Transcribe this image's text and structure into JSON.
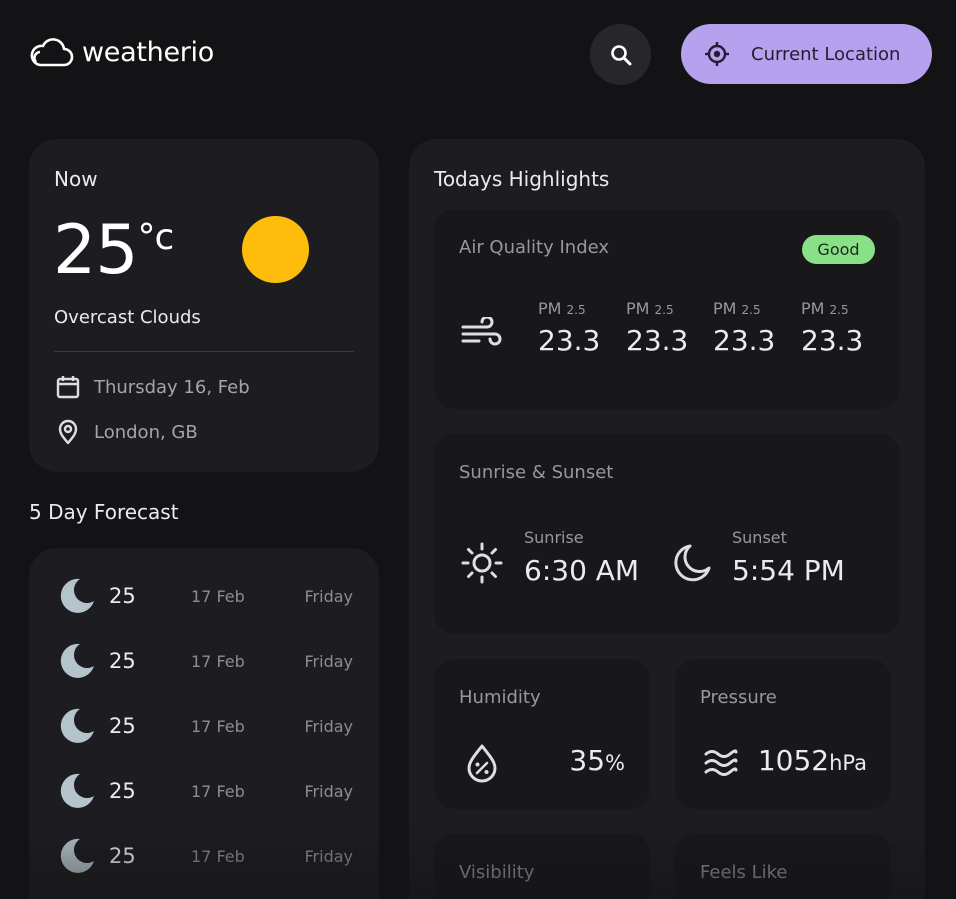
{
  "app": {
    "name": "weatherio"
  },
  "header": {
    "search_icon": "search-icon",
    "location_button": {
      "label": "Current Location",
      "icon": "crosshair-icon"
    }
  },
  "current": {
    "title": "Now",
    "temp": "25",
    "unit": "°c",
    "description": "Overcast Clouds",
    "date": "Thursday 16, Feb",
    "location": "London, GB",
    "sun_color": "#fdbd0a"
  },
  "forecast": {
    "title": "5 Day Forecast",
    "items": [
      {
        "temp": "25",
        "date": "17 Feb",
        "day": "Friday",
        "icon": "moon-icon"
      },
      {
        "temp": "25",
        "date": "17 Feb",
        "day": "Friday",
        "icon": "moon-icon"
      },
      {
        "temp": "25",
        "date": "17 Feb",
        "day": "Friday",
        "icon": "moon-icon"
      },
      {
        "temp": "25",
        "date": "17 Feb",
        "day": "Friday",
        "icon": "moon-icon"
      },
      {
        "temp": "25",
        "date": "17 Feb",
        "day": "Friday",
        "icon": "moon-icon"
      }
    ]
  },
  "highlights": {
    "title": "Todays Highlights",
    "aqi": {
      "label": "Air Quality Index",
      "badge": "Good",
      "badge_color": "#89e087",
      "items": [
        {
          "label": "PM",
          "sub": "2.5",
          "value": "23.3"
        },
        {
          "label": "PM",
          "sub": "2.5",
          "value": "23.3"
        },
        {
          "label": "PM",
          "sub": "2.5",
          "value": "23.3"
        },
        {
          "label": "PM",
          "sub": "2.5",
          "value": "23.3"
        }
      ]
    },
    "sun": {
      "label": "Sunrise & Sunset",
      "sunrise_label": "Sunrise",
      "sunrise": "6:30 AM",
      "sunset_label": "Sunset",
      "sunset": "5:54 PM"
    },
    "humidity": {
      "label": "Humidity",
      "value": "35",
      "unit": "%"
    },
    "pressure": {
      "label": "Pressure",
      "value": "1052",
      "unit": "hPa"
    },
    "visibility": {
      "label": "Visibility"
    },
    "feels_like": {
      "label": "Feels Like"
    }
  },
  "colors": {
    "accent": "#b6a1ee",
    "background": "#131315",
    "card": "#1d1d21"
  }
}
